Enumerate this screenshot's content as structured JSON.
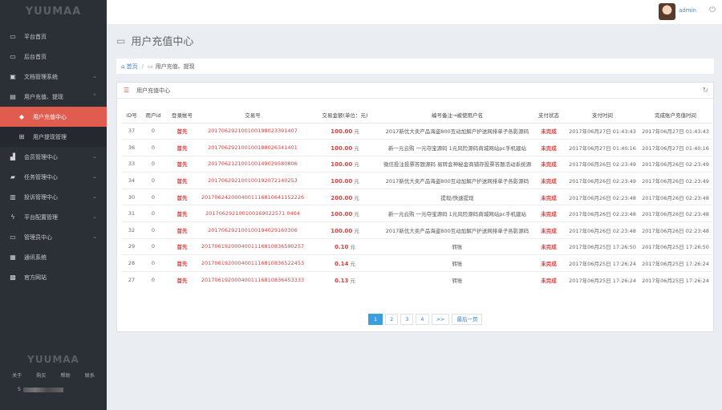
{
  "sidebar": {
    "logo": "YUUMAA",
    "items": [
      {
        "label": "平台首页",
        "icon": "laptop-icon",
        "chev": ""
      },
      {
        "label": "后台首页",
        "icon": "laptop-icon",
        "chev": ""
      },
      {
        "label": "文档管理系统",
        "icon": "book-icon",
        "chev": "⌄"
      },
      {
        "label": "用户充值、提现",
        "icon": "card-icon",
        "chev": "⌃"
      },
      {
        "label": "用户充值中心",
        "icon": "tag-icon",
        "chev": ""
      },
      {
        "label": "用户提现管理",
        "icon": "grid-icon",
        "chev": ""
      },
      {
        "label": "会员管理中心",
        "icon": "signal-icon",
        "chev": "⌄"
      },
      {
        "label": "任务管理中心",
        "icon": "briefcase-icon",
        "chev": "⌄"
      },
      {
        "label": "投诉管理中心",
        "icon": "inbox-icon",
        "chev": "⌄"
      },
      {
        "label": "平台配置管理",
        "icon": "bolt-icon",
        "chev": "⌄"
      },
      {
        "label": "管理员中心",
        "icon": "desktop-icon",
        "chev": "⌄"
      },
      {
        "label": "通讯系统",
        "icon": "calendar-icon",
        "chev": ""
      },
      {
        "label": "官方网站",
        "icon": "image-icon",
        "chev": ""
      }
    ],
    "bottom_logo": "YUUMAA",
    "links": [
      "关于",
      "购买",
      "帮助",
      "联系"
    ],
    "copyright_prefix": "S"
  },
  "topbar": {
    "username": "admin"
  },
  "page": {
    "title": "用户充值中心",
    "breadcrumb_home": "首页",
    "breadcrumb_current": "用户充值、提现"
  },
  "panel": {
    "title": "用户充值中心"
  },
  "table": {
    "headers": [
      "ID号",
      "用户id",
      "登录帐号",
      "交易号",
      "交易金额(单位：元)",
      "编号备注→被使用户名",
      "支付状态",
      "支付时间",
      "完成账户充值时间"
    ],
    "unit": "元",
    "rows": [
      {
        "id": "37",
        "uid": "0",
        "acct": "首先",
        "txn": "201706292100100198023391407",
        "amt": "100.00",
        "desc": "2017新优大卖产品海盗800互动加解户护送网排单子各影源码",
        "status": "未完成",
        "pay": "2017年06月27日 01:43:43",
        "done": "2017年06月27日 01:43:43"
      },
      {
        "id": "36",
        "uid": "0",
        "acct": "首先",
        "txn": "201706292100100188026341401",
        "amt": "100.00",
        "desc": "新一元云购 一元夺宝源码 1元风险源码商城网站pc手机建站",
        "status": "未完成",
        "pay": "2017年06月27日 01:40:16",
        "done": "2017年06月27日 01:40:16"
      },
      {
        "id": "33",
        "uid": "0",
        "acct": "首先",
        "txn": "201706212100100149029580806",
        "amt": "100.00",
        "desc": "微信投注投票答题源码 易转会神秘金商铺存投票答题活动系统源码",
        "status": "未完成",
        "pay": "2017年06月26日 02:23:49",
        "done": "2017年06月26日 02:23:49"
      },
      {
        "id": "34",
        "uid": "0",
        "acct": "首先",
        "txn": "201706292100100192072140253",
        "amt": "100.00",
        "desc": "2017新优大卖产品海盗800互动加解户护送网排单子各影源码",
        "status": "未完成",
        "pay": "2017年06月26日 02:23:49",
        "done": "2017年06月26日 02:23:49"
      },
      {
        "id": "30",
        "uid": "0",
        "acct": "首先",
        "txn": "2017062420004001116810641152226",
        "amt": "200.00",
        "desc": "提现/快速提现",
        "status": "未完成",
        "pay": "2017年06月26日 02:23:48",
        "done": "2017年06月26日 02:23:48"
      },
      {
        "id": "31",
        "uid": "0",
        "acct": "首先",
        "txn": "201706292100100169022571 0404",
        "amt": "100.00",
        "desc": "新一元云购 一元夺宝源码 1元风险源码商城网站pc手机建站",
        "status": "未完成",
        "pay": "2017年06月26日 02:23:48",
        "done": "2017年06月26日 02:23:48"
      },
      {
        "id": "32",
        "uid": "0",
        "acct": "首先",
        "txn": "201706292100100194029160306",
        "amt": "100.00",
        "desc": "2017新优大卖产品海盗800互动加解户护送网排单子各影源码",
        "status": "未完成",
        "pay": "2017年06月26日 02:23:48",
        "done": "2017年06月26日 02:23:48"
      },
      {
        "id": "29",
        "uid": "0",
        "acct": "首先",
        "txn": "2017061920004001116810836590257",
        "amt": "0.10",
        "desc": "转账",
        "status": "未完成",
        "pay": "2017年06月25日 17:26:50",
        "done": "2017年06月25日 17:26:50"
      },
      {
        "id": "28",
        "uid": "0",
        "acct": "首先",
        "txn": "2017061920004001116810836522453",
        "amt": "0.14",
        "desc": "转账",
        "status": "未完成",
        "pay": "2017年06月25日 17:26:24",
        "done": "2017年06月25日 17:26:24"
      },
      {
        "id": "27",
        "uid": "0",
        "acct": "首先",
        "txn": "2017061920004001116810836453333",
        "amt": "0.13",
        "desc": "转账",
        "status": "未完成",
        "pay": "2017年06月25日 17:26:24",
        "done": "2017年06月25日 17:26:24"
      }
    ]
  },
  "pager": {
    "pages": [
      "1",
      "2",
      "3",
      "4"
    ],
    "next": ">>",
    "last": "最后一页"
  }
}
